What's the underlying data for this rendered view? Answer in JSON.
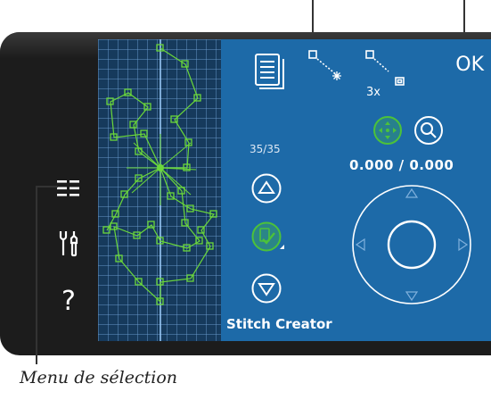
{
  "app": {
    "screen_title": "Stitch Creator",
    "ok_label": "OK"
  },
  "toolbar": {
    "counter": "35/35",
    "multiplier": "3x",
    "coordinates": "0.000 / 0.000"
  },
  "annotations": {
    "menu_caption": "Menu de sélection"
  },
  "icons": {
    "rail": [
      "selection-menu-icon",
      "settings-tools-icon",
      "help-icon"
    ],
    "toolbar": [
      "document-icon",
      "single-stitch-icon",
      "triple-stitch-icon",
      "move-icon",
      "zoom-icon",
      "arrow-up-icon",
      "arrow-down-icon",
      "edit-stitch-icon",
      "directional-wheel-icon"
    ]
  },
  "colors": {
    "screen_bg": "#1d6aa8",
    "grid_bg": "#163a5c",
    "stitch_green": "#6bd83a",
    "accent_green": "#4cc23a",
    "frame": "#1c1c1c"
  }
}
